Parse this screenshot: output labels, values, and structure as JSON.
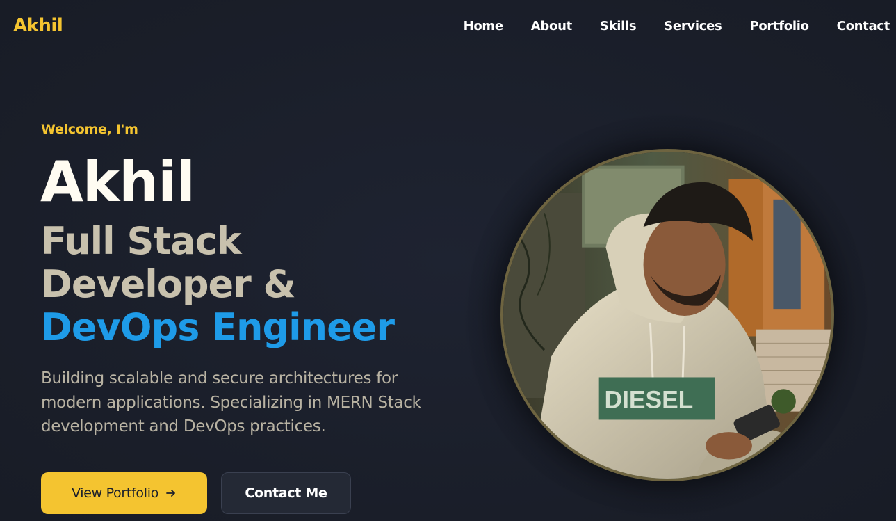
{
  "brand": {
    "logo": "Akhil",
    "accent": "#f4c430",
    "highlight": "#1e9be8"
  },
  "nav": {
    "items": [
      {
        "label": "Home"
      },
      {
        "label": "About"
      },
      {
        "label": "Skills"
      },
      {
        "label": "Services"
      },
      {
        "label": "Portfolio"
      },
      {
        "label": "Contact"
      }
    ]
  },
  "hero": {
    "greeting": "Welcome, I'm",
    "name": "Akhil",
    "role_line1": "Full Stack",
    "role_line2": "Developer &",
    "role_highlight": "DevOps Engineer",
    "description": "Building scalable and secure architectures for modern applications. Specializing in MERN Stack development and DevOps practices.",
    "primary_button": "View Portfolio",
    "primary_button_icon": "arrow-right-icon",
    "secondary_button": "Contact Me",
    "portrait_text": "DIESEL"
  }
}
